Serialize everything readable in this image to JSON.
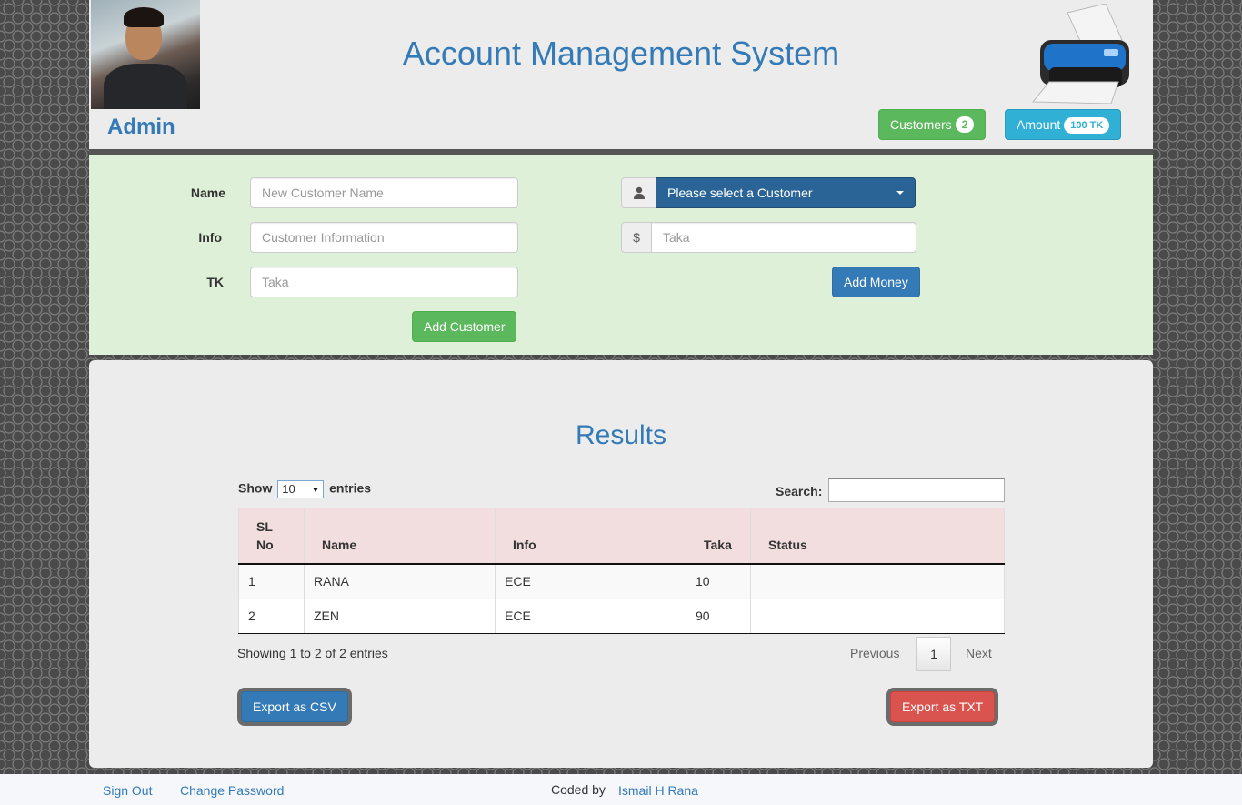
{
  "header": {
    "title": "Account Management System",
    "user_label": "Admin",
    "customers_button": {
      "label": "Customers",
      "count": "2"
    },
    "amount_button": {
      "label": "Amount",
      "value": "100 TK"
    }
  },
  "form": {
    "name_label": "Name",
    "name_placeholder": "New Customer Name",
    "info_label": "Info",
    "info_placeholder": "Customer Information",
    "tk_label": "TK",
    "tk_placeholder": "Taka",
    "add_customer_label": "Add Customer",
    "customer_select_value": "Please select a Customer",
    "currency_symbol": "$",
    "money_placeholder": "Taka",
    "add_money_label": "Add Money"
  },
  "results": {
    "title": "Results",
    "show_label": "Show",
    "page_size": "10",
    "entries_label": "entries",
    "search_label": "Search:",
    "columns": [
      "SL No",
      "Name",
      "Info",
      "Taka",
      "Status"
    ],
    "rows": [
      {
        "sl": "1",
        "name": "RANA",
        "info": "ECE",
        "taka": "10",
        "status": ""
      },
      {
        "sl": "2",
        "name": "ZEN",
        "info": "ECE",
        "taka": "90",
        "status": ""
      }
    ],
    "info_text": "Showing 1 to 2 of 2 entries",
    "pagination": {
      "previous": "Previous",
      "current": "1",
      "next": "Next"
    },
    "export_csv_label": "Export as CSV",
    "export_txt_label": "Export as TXT"
  },
  "footer": {
    "sign_out": "Sign Out",
    "change_password": "Change Password",
    "coded_by": "Coded by",
    "author": "Ismail H Rana"
  },
  "colors": {
    "primary": "#337ab7",
    "success": "#5cb85c",
    "info": "#31b0d5",
    "danger": "#d9534f",
    "form_bg": "#dff0d8",
    "table_header_bg": "#f2dede"
  }
}
